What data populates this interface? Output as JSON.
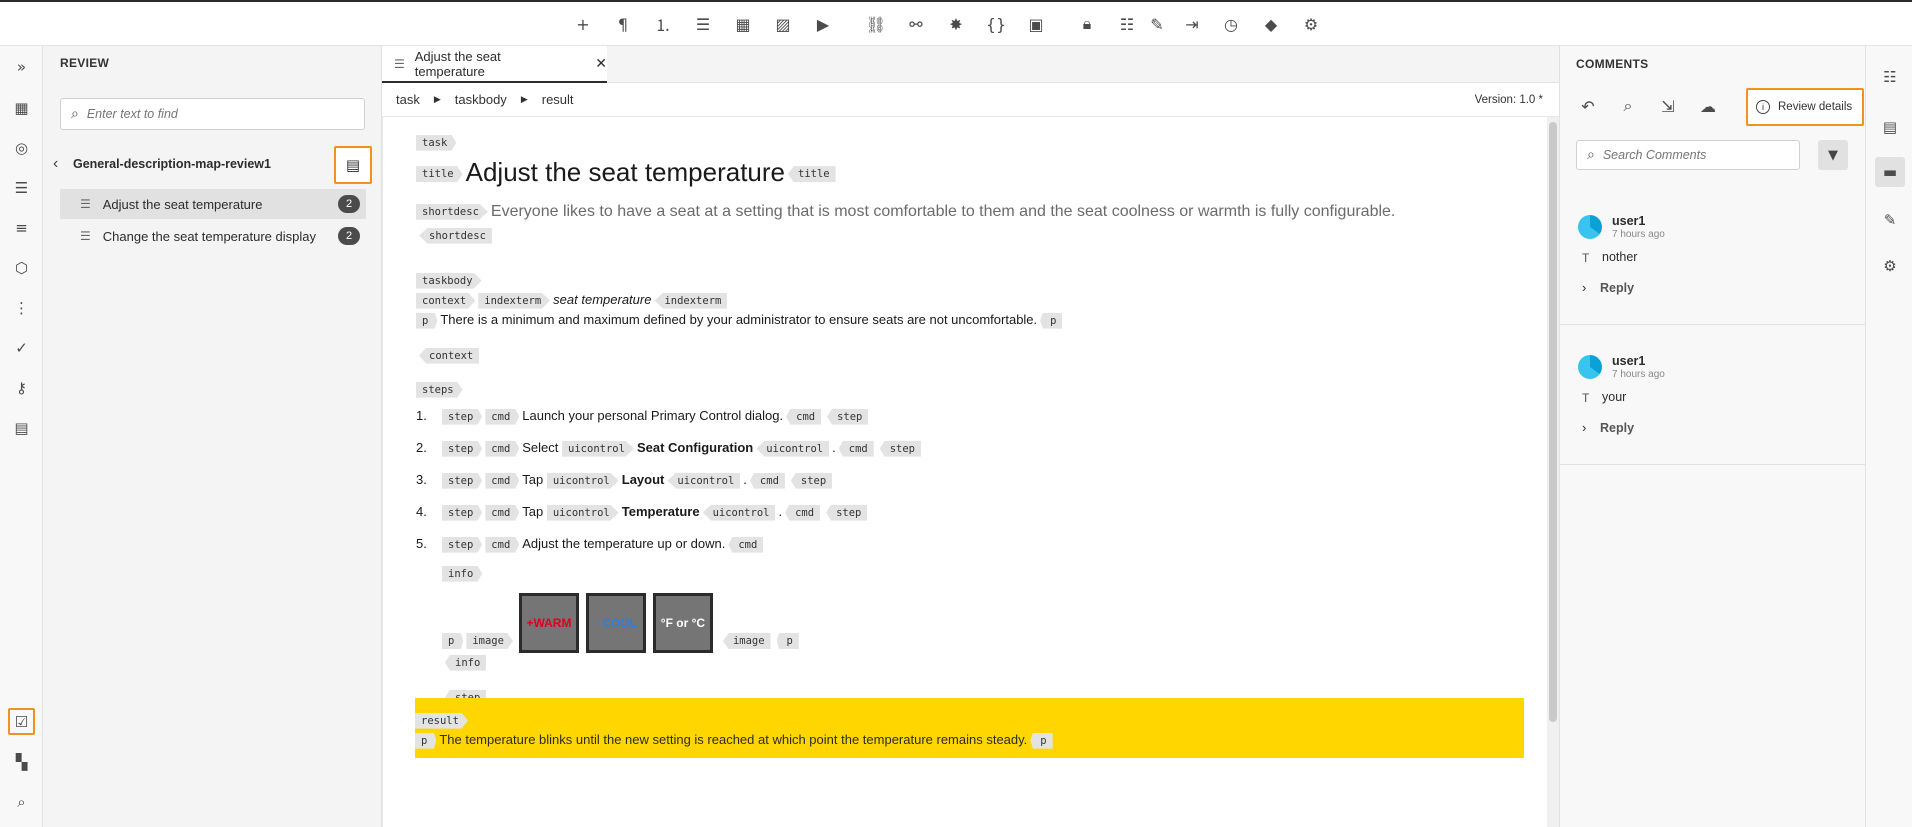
{
  "toolbar": {
    "icons": [
      "plus-icon",
      "paragraph-icon",
      "numbered-list-icon",
      "bulleted-list-icon",
      "table-icon",
      "image-icon",
      "multimedia-icon",
      "link-icon",
      "link-variant-icon",
      "special-char-icon",
      "code-block-icon",
      "content-insert-icon",
      "lock-icon",
      "track-changes-icon",
      "highlight-icon",
      "version-label-icon",
      "history-icon",
      "tag-icon",
      "folder-settings-icon"
    ]
  },
  "left_rail": {
    "icons": [
      "expand-icon",
      "grid-icon",
      "database-icon",
      "outline-icon",
      "list-icon",
      "shapes-icon",
      "numbered-list-icon",
      "check-cross-icon",
      "key-icon",
      "preview-icon",
      "review-icon",
      "apps-icon",
      "find-icon"
    ]
  },
  "review_panel": {
    "title": "REVIEW",
    "search_placeholder": "Enter text to find",
    "map_name": "General-description-map-review1",
    "topics": [
      {
        "label": "Adjust the seat temperature",
        "count": "2"
      },
      {
        "label": "Change the seat temperature display",
        "count": "2"
      }
    ]
  },
  "editor": {
    "tab_title": "Adjust the seat temperature",
    "breadcrumb": [
      "task",
      "taskbody",
      "result"
    ],
    "version": "Version: 1.0 *",
    "doc": {
      "tag_task": "task",
      "tag_title": "title",
      "title": "Adjust the seat temperature",
      "tag_shortdesc": "shortdesc",
      "shortdesc": "Everyone likes to have a seat at a setting that is most comfortable to them and the seat coolness or warmth is fully configurable.",
      "tag_taskbody": "taskbody",
      "tag_context": "context",
      "tag_indexterm": "indexterm",
      "indexterm": "seat temperature",
      "tag_p": "p",
      "context_p": "There is a minimum and maximum defined by your administrator to ensure seats are not uncomfortable.",
      "tag_steps": "steps",
      "tag_step": "step",
      "tag_cmd": "cmd",
      "tag_uicontrol": "uicontrol",
      "tag_info": "info",
      "tag_image": "image",
      "tag_result": "result",
      "step1": "Launch your personal Primary Control dialog.",
      "step2_pre": "Select",
      "step2_ui": "Seat Configuration",
      "step3_pre": "Tap",
      "step3_ui": "Layout",
      "step4_pre": "Tap",
      "step4_ui": "Temperature",
      "step5": "Adjust the temperature up or down.",
      "dot": ".",
      "img_warm": "+WARM",
      "img_cool": "- COOL",
      "img_unit": "°F or °C",
      "result_p": "The temperature blinks until the new setting is reached at which point the temperature remains steady.",
      "step_numbers": [
        "1.",
        "2.",
        "3.",
        "4.",
        "5."
      ]
    }
  },
  "comments_panel": {
    "title": "COMMENTS",
    "review_details": "Review details",
    "search_placeholder": "Search Comments",
    "items": [
      {
        "user": "user1",
        "time": "7 hours ago",
        "text": "nother",
        "reply": "Reply"
      },
      {
        "user": "user1",
        "time": "7 hours ago",
        "text": "your",
        "reply": "Reply"
      }
    ]
  },
  "colors": {
    "accent": "#f0921e",
    "highlight": "#ffd600",
    "warm": "#e0001b",
    "cool": "#2f7de1"
  }
}
